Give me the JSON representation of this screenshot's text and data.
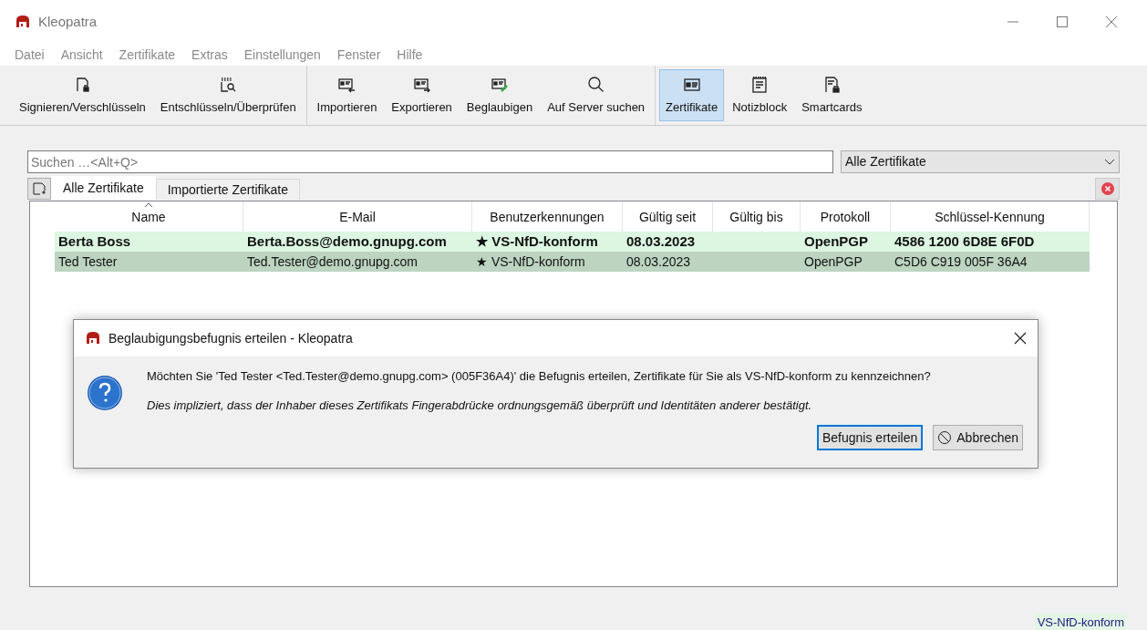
{
  "window": {
    "title": "Kleopatra"
  },
  "menu": [
    "Datei",
    "Ansicht",
    "Zertifikate",
    "Extras",
    "Einstellungen",
    "Fenster",
    "Hilfe"
  ],
  "toolbar": [
    [
      {
        "label": "Signieren/Verschlüsseln",
        "kind": "sign",
        "selected": false
      },
      {
        "label": "Entschlüsseln/Überprüfen",
        "kind": "decrypt",
        "selected": false
      }
    ],
    [
      {
        "label": "Importieren",
        "kind": "import",
        "selected": false
      },
      {
        "label": "Exportieren",
        "kind": "export",
        "selected": false
      },
      {
        "label": "Beglaubigen",
        "kind": "certify",
        "selected": false
      },
      {
        "label": "Auf Server suchen",
        "kind": "search",
        "selected": false
      }
    ],
    [
      {
        "label": "Zertifikate",
        "kind": "cert",
        "selected": true
      },
      {
        "label": "Notizblock",
        "kind": "notepad",
        "selected": false
      },
      {
        "label": "Smartcards",
        "kind": "smartcard",
        "selected": false
      }
    ]
  ],
  "search": {
    "placeholder": "Suchen …<Alt+Q>"
  },
  "filter": {
    "value": "Alle Zertifikate"
  },
  "tabs": [
    {
      "label": "Alle Zertifikate",
      "selected": true
    },
    {
      "label": "Importierte Zertifikate",
      "selected": false
    }
  ],
  "table": {
    "columns": [
      "Name",
      "E-Mail",
      "Benutzerkennungen",
      "Gültig seit",
      "Gültig bis",
      "Protokoll",
      "Schlüssel-Kennung"
    ],
    "rows": [
      {
        "selected": false,
        "bold": true,
        "cells": [
          "Berta Boss",
          "Berta.Boss@demo.gnupg.com",
          "★ VS-NfD-konform",
          "08.03.2023",
          "",
          "OpenPGP",
          "4586 1200 6D8E 6F0D"
        ]
      },
      {
        "selected": true,
        "bold": false,
        "cells": [
          "Ted Tester",
          "Ted.Tester@demo.gnupg.com",
          "★ VS-NfD-konform",
          "08.03.2023",
          "",
          "OpenPGP",
          "C5D6 C919 005F 36A4"
        ]
      }
    ]
  },
  "dialog": {
    "title": "Beglaubigungsbefugnis erteilen - Kleopatra",
    "question": "Möchten Sie 'Ted Tester <Ted.Tester@demo.gnupg.com> (005F36A4)' die Befugnis erteilen, Zertifikate für Sie als VS-NfD-konform zu kennzeichnen?",
    "note": "Dies impliziert, dass der Inhaber dieses Zertifikats Fingerabdrücke ordnungsgemäß überprüft und Identitäten anderer bestätigt.",
    "buttons": [
      {
        "label": "Befugnis erteilen",
        "kind": "default"
      },
      {
        "label": "Abbrechen",
        "kind": "cancel"
      }
    ]
  },
  "status_bar": {
    "compliance": "VS-NfD-konform"
  }
}
